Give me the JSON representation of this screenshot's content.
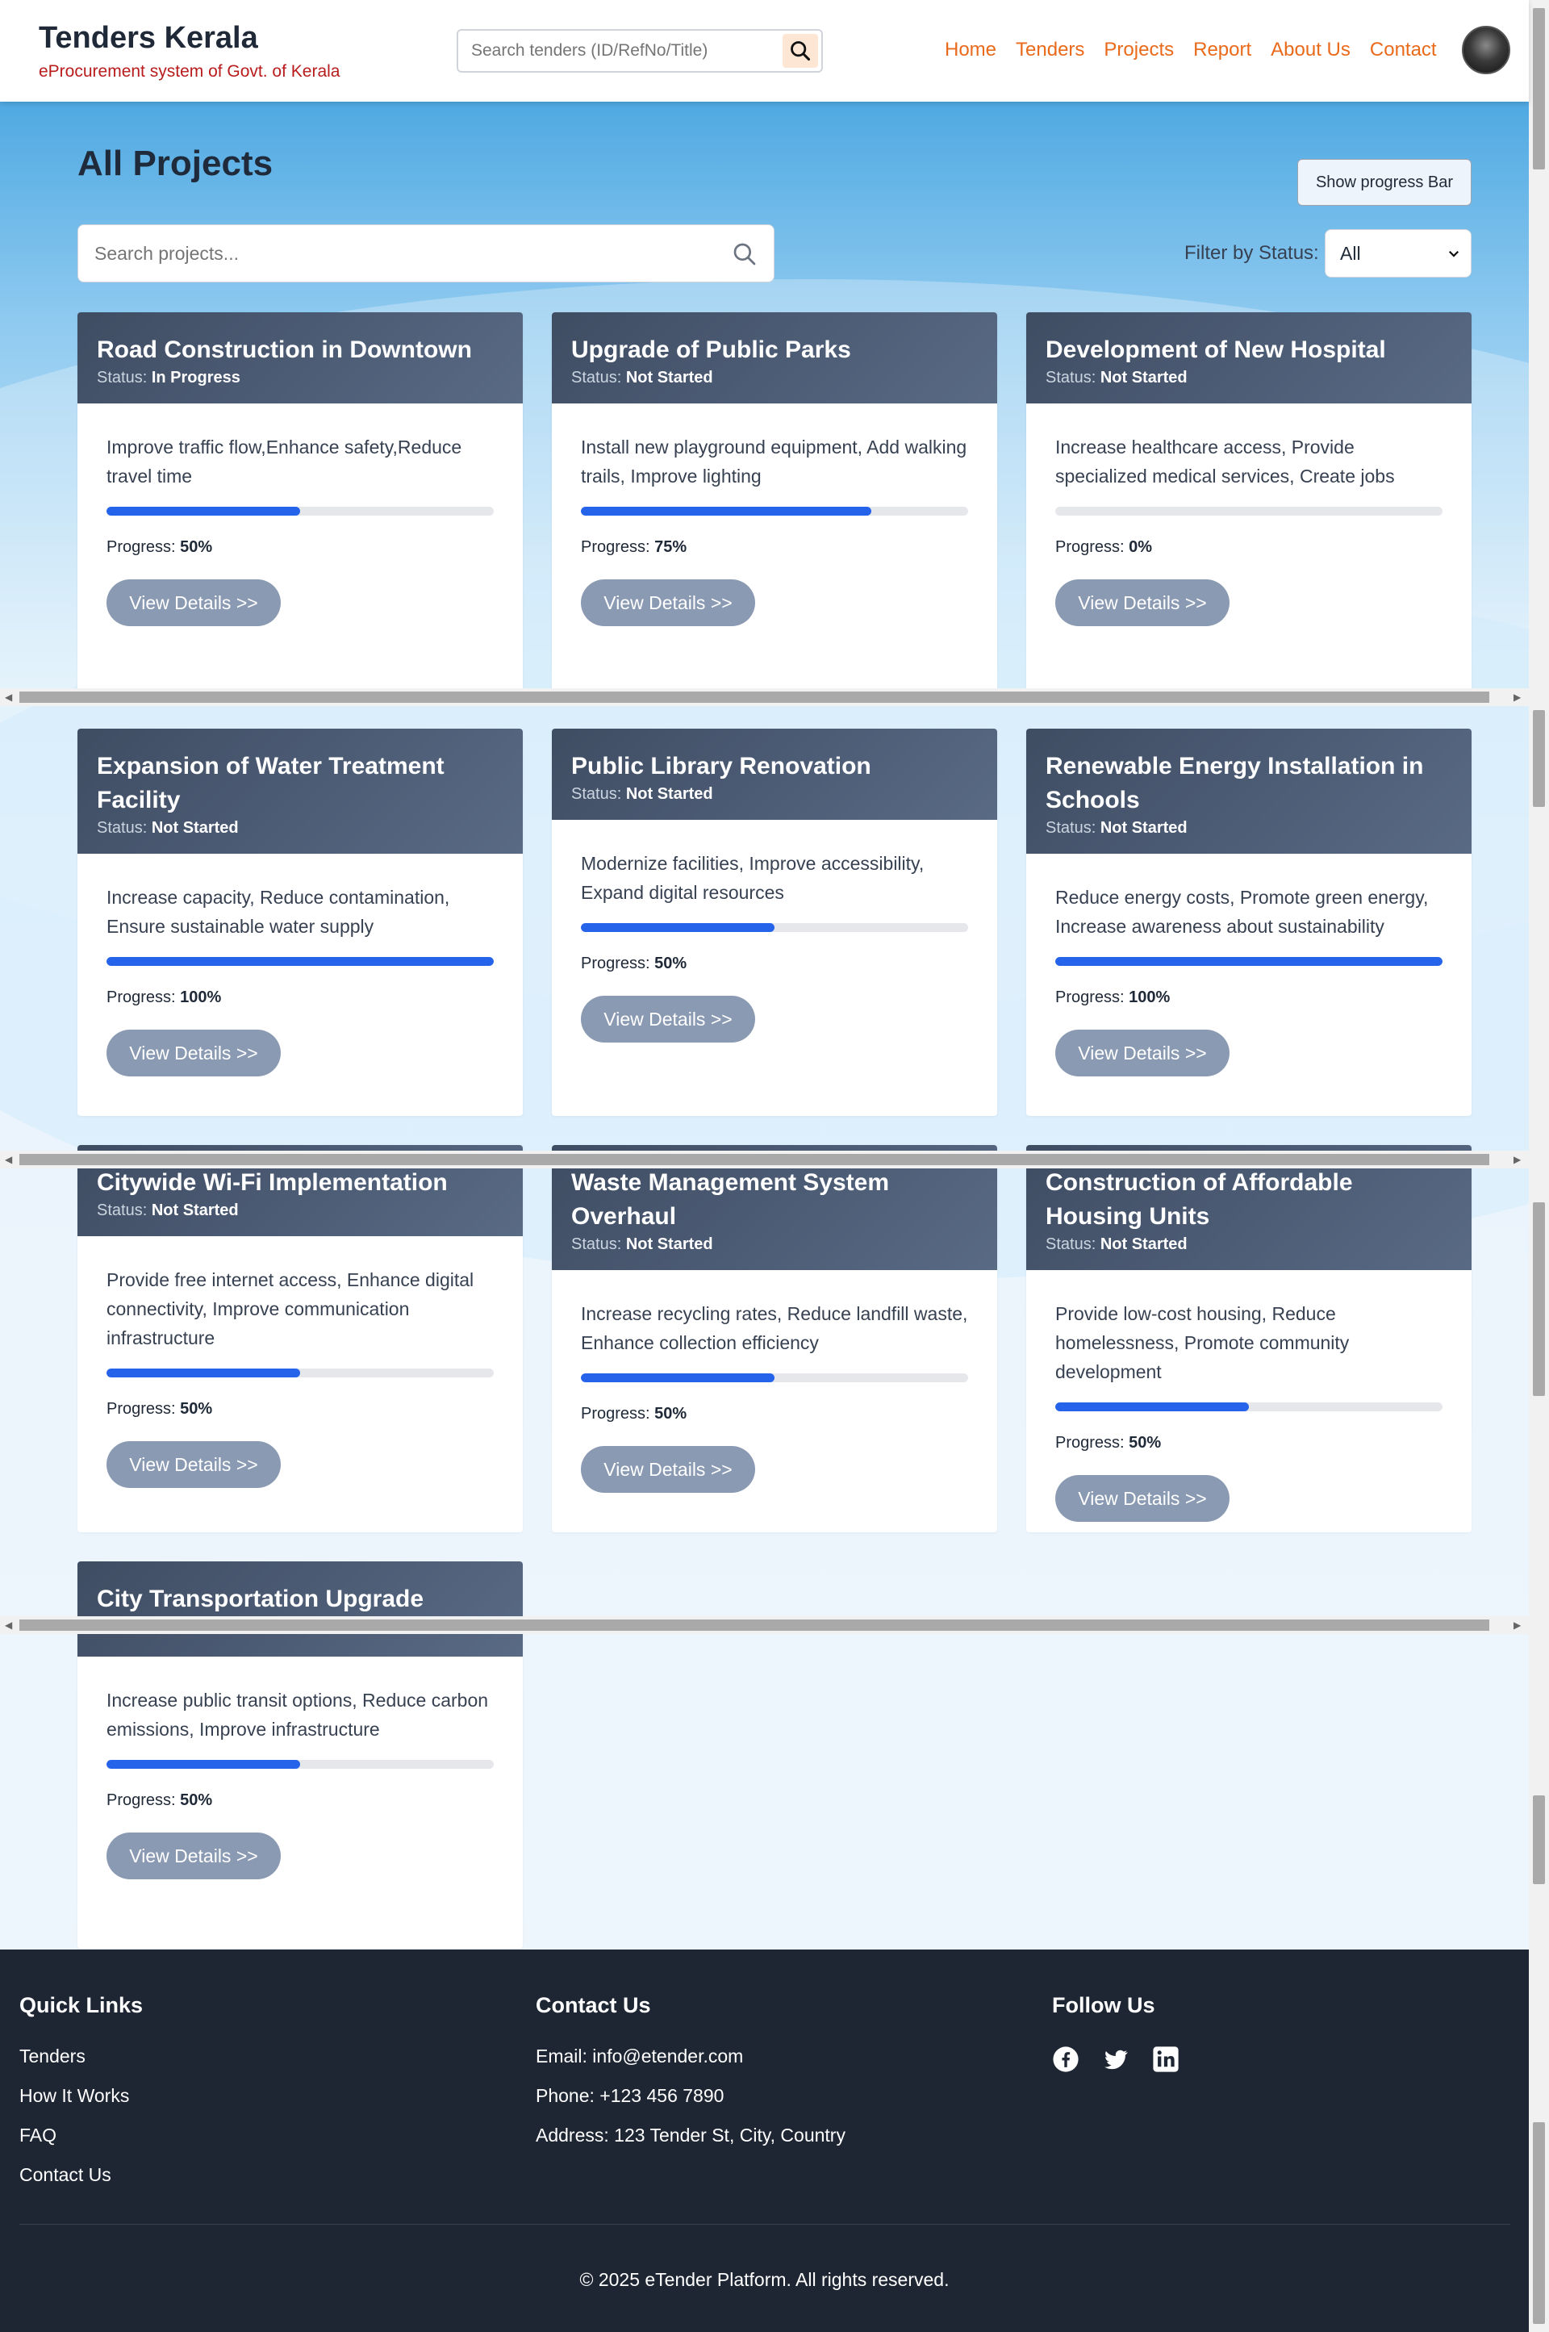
{
  "header": {
    "brand_title": "Tenders Kerala",
    "brand_subtitle": "eProcurement system of Govt. of Kerala",
    "search_placeholder": "Search tenders (ID/RefNo/Title)",
    "nav": [
      "Home",
      "Tenders",
      "Projects",
      "Report",
      "About Us",
      "Contact"
    ]
  },
  "main": {
    "title": "All Projects",
    "progress_toggle_label": "Show progress Bar",
    "search_placeholder": "Search projects...",
    "filter_label": "Filter by Status:",
    "filter_value": "All"
  },
  "labels": {
    "status_prefix": "Status:",
    "progress_prefix": "Progress:",
    "view_details": "View Details >>"
  },
  "projects": [
    {
      "title": "Road Construction in Downtown",
      "status": "In Progress",
      "description": "Improve traffic flow,Enhance safety,Reduce travel time",
      "progress": 50,
      "progress_label": "50%"
    },
    {
      "title": "Upgrade of Public Parks",
      "status": "Not Started",
      "description": "Install new playground equipment, Add walking trails, Improve lighting",
      "progress": 75,
      "progress_label": "75%"
    },
    {
      "title": "Development of New Hospital",
      "status": "Not Started",
      "description": "Increase healthcare access, Provide specialized medical services, Create jobs",
      "progress": 0,
      "progress_label": "0%"
    },
    {
      "title": "Expansion of Water Treatment Facility",
      "status": "Not Started",
      "description": "Increase capacity, Reduce contamination, Ensure sustainable water supply",
      "progress": 100,
      "progress_label": "100%"
    },
    {
      "title": "Public Library Renovation",
      "status": "Not Started",
      "description": "Modernize facilities, Improve accessibility, Expand digital resources",
      "progress": 50,
      "progress_label": "50%"
    },
    {
      "title": "Renewable Energy Installation in Schools",
      "status": "Not Started",
      "description": "Reduce energy costs, Promote green energy, Increase awareness about sustainability",
      "progress": 100,
      "progress_label": "100%"
    },
    {
      "title": "Citywide Wi-Fi Implementation",
      "status": "Not Started",
      "description": "Provide free internet access, Enhance digital connectivity, Improve communication infrastructure",
      "progress": 50,
      "progress_label": "50%"
    },
    {
      "title": "Waste Management System Overhaul",
      "status": "Not Started",
      "description": "Increase recycling rates, Reduce landfill waste, Enhance collection efficiency",
      "progress": 50,
      "progress_label": "50%"
    },
    {
      "title": "Construction of Affordable Housing Units",
      "status": "Not Started",
      "description": "Provide low-cost housing, Reduce homelessness, Promote community development",
      "progress": 50,
      "progress_label": "50%"
    },
    {
      "title": "City Transportation Upgrade",
      "status": "",
      "description": "Increase public transit options, Reduce carbon emissions, Improve infrastructure",
      "progress": 50,
      "progress_label": "50%"
    }
  ],
  "footer": {
    "quick_links_title": "Quick Links",
    "quick_links": [
      "Tenders",
      "How It Works",
      "FAQ",
      "Contact Us"
    ],
    "contact_title": "Contact Us",
    "contact_lines": [
      "Email: info@etender.com",
      "Phone: +123 456 7890",
      "Address: 123 Tender St, City, Country"
    ],
    "follow_title": "Follow Us",
    "social_icons": [
      "facebook-icon",
      "twitter-icon",
      "linkedin-icon"
    ],
    "copyright": "© 2025 eTender Platform. All rights reserved."
  },
  "colors": {
    "nav_accent": "#ea6a1b",
    "brand_subtitle": "#b91c1c",
    "progress_fill": "#2563eb",
    "card_header": "#4a5870",
    "view_button": "#8b9ab3",
    "footer_bg": "#1f2633"
  }
}
